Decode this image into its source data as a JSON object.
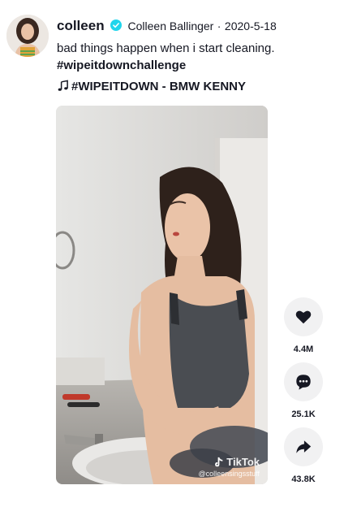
{
  "post": {
    "username": "colleen",
    "nickname": "Colleen Ballinger",
    "separator": "·",
    "date": "2020-5-18",
    "description": "bad things happen when i start cleaning.",
    "hashtag": "#wipeitdownchallenge",
    "music": "#WIPEITDOWN - BMW KENNY"
  },
  "video": {
    "watermark_brand": "TikTok",
    "watermark_user": "@colleensingsstuff"
  },
  "actions": {
    "likes": "4.4M",
    "comments": "25.1K",
    "shares": "43.8K"
  },
  "icons": {
    "verified": "verified-badge-icon",
    "music": "music-note-icon",
    "like": "heart-icon",
    "comment": "comment-icon",
    "share": "share-arrow-icon"
  },
  "colors": {
    "verified": "#20d5ec",
    "text": "#161823",
    "button_bg": "#f1f1f2"
  }
}
